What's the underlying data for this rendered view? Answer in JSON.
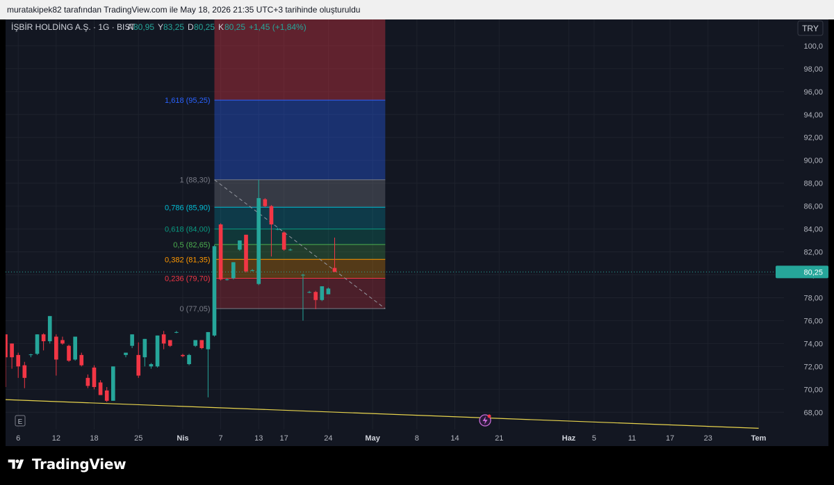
{
  "caption": "muratakipek82 tarafından TradingView.com ile May 18, 2026 21:35 UTC+3 tarihinde oluşturuldu",
  "logo_text": "TradingView",
  "colors": {
    "background": "#131722",
    "bull": "#26a69a",
    "bear": "#f23645",
    "trendline": "#e8d44d",
    "axis_text": "#b2b5be",
    "grid": "#1e222d"
  },
  "legend": {
    "symbol": "İŞBİR HOLDİNG A.Ş. · 1G · BIST",
    "items": [
      {
        "key": "A",
        "value": "80,95"
      },
      {
        "key": "Y",
        "value": "83,25"
      },
      {
        "key": "D",
        "value": "80,25"
      },
      {
        "key": "K",
        "value": "80,25"
      }
    ],
    "change": "+1,45 (+1,84%)"
  },
  "currency_badge": "TRY",
  "last_price_label": "80,25",
  "earnings_marker": "E",
  "chart_data": {
    "type": "candlestick",
    "currency": "TRY",
    "y_axis": {
      "ticks": [
        "68,00",
        "70,00",
        "72,00",
        "74,00",
        "76,00",
        "78,00",
        "80,00",
        "82,00",
        "84,00",
        "86,00",
        "88,00",
        "90,00",
        "92,00",
        "94,00",
        "96,00",
        "98,00",
        "100,0"
      ],
      "ylim": [
        66.5,
        102.3
      ]
    },
    "x_axis": {
      "tick_labels": [
        {
          "label": "6",
          "day": 0
        },
        {
          "label": "12",
          "day": 6
        },
        {
          "label": "18",
          "day": 12
        },
        {
          "label": "25",
          "day": 19
        },
        {
          "label": "Nis",
          "day": 26
        },
        {
          "label": "7",
          "day": 32
        },
        {
          "label": "13",
          "day": 38
        },
        {
          "label": "17",
          "day": 42
        },
        {
          "label": "24",
          "day": 49
        },
        {
          "label": "May",
          "day": 56
        },
        {
          "label": "8",
          "day": 63
        },
        {
          "label": "14",
          "day": 69
        },
        {
          "label": "21",
          "day": 76
        },
        {
          "label": "Haz",
          "day": 87
        },
        {
          "label": "5",
          "day": 91
        },
        {
          "label": "11",
          "day": 97
        },
        {
          "label": "17",
          "day": 103
        },
        {
          "label": "23",
          "day": 109
        },
        {
          "label": "Tem",
          "day": 117
        }
      ],
      "day_range": [
        -2,
        121
      ]
    },
    "candles": [
      {
        "d": -2,
        "o": 74.8,
        "h": 74.8,
        "l": 70.2,
        "c": 72.8
      },
      {
        "d": -1,
        "o": 74.0,
        "h": 74.0,
        "l": 71.8,
        "c": 72.8
      },
      {
        "d": 0,
        "o": 73.0,
        "h": 73.2,
        "l": 71.0,
        "c": 72.0
      },
      {
        "d": 1,
        "o": 72.1,
        "h": 72.4,
        "l": 70.1,
        "c": 71.0
      },
      {
        "d": 2,
        "o": 73.0,
        "h": 73.1,
        "l": 72.8,
        "c": 73.05
      },
      {
        "d": 3,
        "o": 73.1,
        "h": 74.8,
        "l": 73.0,
        "c": 74.8
      },
      {
        "d": 4,
        "o": 74.8,
        "h": 74.9,
        "l": 73.4,
        "c": 74.2
      },
      {
        "d": 5,
        "o": 74.2,
        "h": 76.4,
        "l": 74.0,
        "c": 76.4
      },
      {
        "d": 6,
        "o": 74.6,
        "h": 74.8,
        "l": 71.2,
        "c": 72.6
      },
      {
        "d": 7,
        "o": 74.3,
        "h": 74.6,
        "l": 73.9,
        "c": 74.0
      },
      {
        "d": 8,
        "o": 73.8,
        "h": 73.9,
        "l": 72.4,
        "c": 72.5
      },
      {
        "d": 9,
        "o": 72.6,
        "h": 74.6,
        "l": 72.5,
        "c": 74.6
      },
      {
        "d": 10,
        "o": 73.0,
        "h": 73.2,
        "l": 72.0,
        "c": 72.1
      },
      {
        "d": 11,
        "o": 71.0,
        "h": 71.3,
        "l": 70.1,
        "c": 70.3
      },
      {
        "d": 12,
        "o": 71.9,
        "h": 72.1,
        "l": 70.0,
        "c": 70.2
      },
      {
        "d": 13,
        "o": 70.6,
        "h": 70.8,
        "l": 69.5,
        "c": 69.5
      },
      {
        "d": 14,
        "o": 69.9,
        "h": 70.2,
        "l": 68.9,
        "c": 69.0
      },
      {
        "d": 15,
        "o": 69.0,
        "h": 72.0,
        "l": 69.0,
        "c": 72.0
      },
      {
        "d": 17,
        "o": 73.0,
        "h": 73.2,
        "l": 72.8,
        "c": 73.2
      },
      {
        "d": 18,
        "o": 73.8,
        "h": 74.8,
        "l": 73.6,
        "c": 74.8
      },
      {
        "d": 19,
        "o": 73.0,
        "h": 74.1,
        "l": 71.0,
        "c": 71.2
      },
      {
        "d": 20,
        "o": 72.8,
        "h": 74.4,
        "l": 72.0,
        "c": 74.4
      },
      {
        "d": 21,
        "o": 72.0,
        "h": 72.3,
        "l": 71.8,
        "c": 72.2
      },
      {
        "d": 22,
        "o": 72.0,
        "h": 74.7,
        "l": 71.9,
        "c": 74.7
      },
      {
        "d": 23,
        "o": 74.8,
        "h": 75.1,
        "l": 73.5,
        "c": 74.0
      },
      {
        "d": 24,
        "o": 74.3,
        "h": 74.3,
        "l": 73.7,
        "c": 73.8
      },
      {
        "d": 25,
        "o": 75.0,
        "h": 75.1,
        "l": 74.9,
        "c": 75.0
      },
      {
        "d": 26,
        "o": 73.0,
        "h": 73.1,
        "l": 72.8,
        "c": 72.9
      },
      {
        "d": 27,
        "o": 72.2,
        "h": 73.1,
        "l": 72.1,
        "c": 73.0
      },
      {
        "d": 28,
        "o": 73.8,
        "h": 74.3,
        "l": 73.7,
        "c": 74.3
      },
      {
        "d": 29,
        "o": 74.3,
        "h": 74.3,
        "l": 73.5,
        "c": 73.6
      },
      {
        "d": 30,
        "o": 73.5,
        "h": 75.0,
        "l": 69.3,
        "c": 75.0
      },
      {
        "d": 31,
        "o": 74.7,
        "h": 82.6,
        "l": 74.6,
        "c": 82.5
      },
      {
        "d": 32,
        "o": 84.4,
        "h": 84.5,
        "l": 79.5,
        "c": 79.6
      },
      {
        "d": 33,
        "o": 79.6,
        "h": 79.7,
        "l": 79.5,
        "c": 79.6
      },
      {
        "d": 34,
        "o": 79.7,
        "h": 81.1,
        "l": 79.6,
        "c": 81.1
      },
      {
        "d": 35,
        "o": 82.2,
        "h": 83.0,
        "l": 82.1,
        "c": 83.0
      },
      {
        "d": 36,
        "o": 83.5,
        "h": 83.5,
        "l": 80.2,
        "c": 80.3
      },
      {
        "d": 37,
        "o": 80.4,
        "h": 80.5,
        "l": 80.3,
        "c": 80.4
      },
      {
        "d": 38,
        "o": 79.2,
        "h": 88.3,
        "l": 79.1,
        "c": 86.7
      },
      {
        "d": 39,
        "o": 86.6,
        "h": 86.7,
        "l": 85.9,
        "c": 86.0
      },
      {
        "d": 40,
        "o": 86.0,
        "h": 86.1,
        "l": 81.6,
        "c": 84.4
      },
      {
        "d": 41,
        "o": 84.0,
        "h": 84.1,
        "l": 83.9,
        "c": 84.0
      },
      {
        "d": 42,
        "o": 83.7,
        "h": 83.8,
        "l": 82.1,
        "c": 82.2
      },
      {
        "d": 43,
        "o": 82.2,
        "h": 82.3,
        "l": 82.1,
        "c": 82.2
      },
      {
        "d": 45,
        "o": 80.0,
        "h": 80.1,
        "l": 76.0,
        "c": 80.0
      },
      {
        "d": 46,
        "o": 78.5,
        "h": 78.6,
        "l": 78.4,
        "c": 78.5
      },
      {
        "d": 47,
        "o": 78.5,
        "h": 78.6,
        "l": 77.0,
        "c": 77.8
      },
      {
        "d": 48,
        "o": 77.8,
        "h": 79.0,
        "l": 77.7,
        "c": 79.0
      },
      {
        "d": 49,
        "o": 78.3,
        "h": 78.9,
        "l": 78.3,
        "c": 78.8
      },
      {
        "d": 50,
        "o": 80.6,
        "h": 83.25,
        "l": 80.25,
        "c": 80.25
      }
    ],
    "fibonacci": {
      "day_start": 31,
      "day_end": 58,
      "levels": [
        {
          "ratio": "0",
          "price": 77.05,
          "label": "0 (77,05)",
          "color": "#787b86",
          "fill": null
        },
        {
          "ratio": "0.236",
          "price": 79.7,
          "label": "0,236 (79,70)",
          "color": "#f23645",
          "fill": "rgba(242,54,69,0.25)"
        },
        {
          "ratio": "0.382",
          "price": 81.35,
          "label": "0,382 (81,35)",
          "color": "#ff9800",
          "fill": "rgba(255,152,0,0.28)"
        },
        {
          "ratio": "0.5",
          "price": 82.65,
          "label": "0,5 (82,65)",
          "color": "#4caf50",
          "fill": "rgba(76,175,80,0.25)"
        },
        {
          "ratio": "0.618",
          "price": 84.0,
          "label": "0,618 (84,00)",
          "color": "#089981",
          "fill": "rgba(8,153,129,0.25)"
        },
        {
          "ratio": "0.786",
          "price": 85.9,
          "label": "0,786 (85,90)",
          "color": "#00bcd4",
          "fill": "rgba(0,188,212,0.22)"
        },
        {
          "ratio": "1",
          "price": 88.3,
          "label": "1 (88,30)",
          "color": "#787b86",
          "fill": "rgba(120,123,134,0.35)"
        },
        {
          "ratio": "1.618",
          "price": 95.25,
          "label": "1,618 (95,25)",
          "color": "#2962ff",
          "fill": "rgba(41,98,255,0.35)"
        },
        {
          "ratio": "2.618",
          "price": 106.45,
          "label": "",
          "color": "#f23645",
          "fill": "rgba(242,54,69,0.35)"
        }
      ]
    },
    "trend_line": {
      "from": {
        "day": -2,
        "price": 69.1
      },
      "to": {
        "day": 117,
        "price": 66.6
      }
    },
    "last_price": 80.25
  }
}
